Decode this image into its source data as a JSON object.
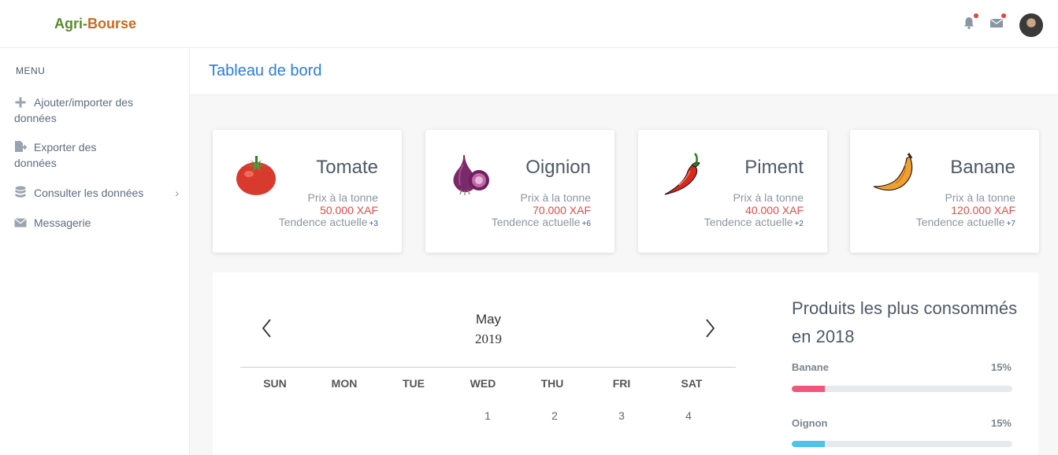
{
  "brand": {
    "part1": "Agri-",
    "part2": "Bourse"
  },
  "topbar": {
    "icons": [
      "bell-icon",
      "envelope-icon",
      "user-avatar"
    ]
  },
  "sidebar": {
    "menu_title": "MENU",
    "items": [
      {
        "line1": "Ajouter/importer des",
        "line2": "données",
        "icon": "plus-icon"
      },
      {
        "line1": "Exporter des",
        "line2": "données",
        "icon": "file-export-icon"
      },
      {
        "label": "Consulter les données",
        "icon": "database-icon",
        "chevron": "›"
      },
      {
        "label": "Messagerie",
        "icon": "envelope-icon"
      }
    ]
  },
  "page": {
    "title": "Tableau de bord"
  },
  "products": [
    {
      "name": "Tomate",
      "price_label": "Prix à la tonne",
      "price": "50.000 XAF",
      "trend_label": "Tendence actuelle",
      "trend": "+3",
      "icon": "tomato-icon"
    },
    {
      "name": "Oignion",
      "price_label": "Prix à la tonne",
      "price": "70.000 XAF",
      "trend_label": "Tendence actuelle",
      "trend": "+6",
      "icon": "onion-icon"
    },
    {
      "name": "Piment",
      "price_label": "Prix à la tonne",
      "price": "40.000 XAF",
      "trend_label": "Tendence actuelle",
      "trend": "+2",
      "icon": "chili-pepper-icon"
    },
    {
      "name": "Banane",
      "price_label": "Prix à la tonne",
      "price": "120.000 XAF",
      "trend_label": "Tendence actuelle",
      "trend": "+7",
      "icon": "banana-icon"
    }
  ],
  "calendar": {
    "month": "May",
    "year": "2019",
    "weekdays": [
      "SUN",
      "MON",
      "TUE",
      "WED",
      "THU",
      "FRI",
      "SAT"
    ],
    "first_row": [
      "",
      "",
      "",
      "1",
      "2",
      "3",
      "4"
    ]
  },
  "stats": {
    "title": "Produits les plus consommés en 2018",
    "items": [
      {
        "name": "Banane",
        "percent": "15%",
        "value": 0.15,
        "color": "#f0577a"
      },
      {
        "name": "Oignon",
        "percent": "15%",
        "value": 0.15,
        "color": "#4fc3e8"
      }
    ]
  }
}
